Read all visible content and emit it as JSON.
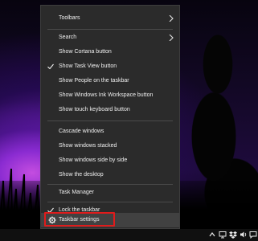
{
  "menu": {
    "items": [
      {
        "label": "Toolbars",
        "submenu": true,
        "checked": false
      },
      {
        "label": "Search",
        "submenu": true,
        "checked": false
      },
      {
        "label": "Show Cortana button",
        "submenu": false,
        "checked": false
      },
      {
        "label": "Show Task View button",
        "submenu": false,
        "checked": true
      },
      {
        "label": "Show People on the taskbar",
        "submenu": false,
        "checked": false
      },
      {
        "label": "Show Windows Ink Workspace button",
        "submenu": false,
        "checked": false
      },
      {
        "label": "Show touch keyboard button",
        "submenu": false,
        "checked": false
      },
      {
        "label": "Cascade windows",
        "submenu": false,
        "checked": false
      },
      {
        "label": "Show windows stacked",
        "submenu": false,
        "checked": false
      },
      {
        "label": "Show windows side by side",
        "submenu": false,
        "checked": false
      },
      {
        "label": "Show the desktop",
        "submenu": false,
        "checked": false
      },
      {
        "label": "Task Manager",
        "submenu": false,
        "checked": false
      },
      {
        "label": "Lock the taskbar",
        "submenu": false,
        "checked": true
      },
      {
        "label": "Taskbar settings",
        "submenu": false,
        "checked": false,
        "icon": "gear-icon",
        "highlighted": true
      }
    ]
  },
  "taskbar": {
    "tray_icons": [
      "chevron-up-icon",
      "network-icon",
      "dropbox-icon",
      "volume-icon",
      "speech-bubble-icon"
    ]
  },
  "colors": {
    "menu_background": "#2b2b2b",
    "menu_text": "#f0f0f0",
    "hover_background": "#414141",
    "highlight_border": "#e01b1b",
    "taskbar": "#101010"
  }
}
